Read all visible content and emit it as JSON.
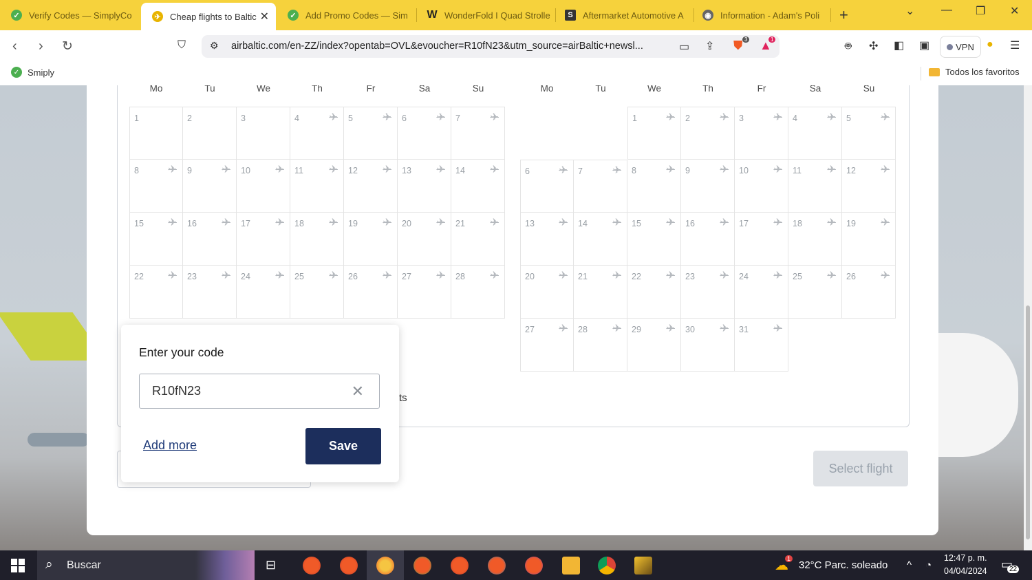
{
  "tabs": [
    {
      "label": "Verify Codes — SimplyCo",
      "color": "#4caf50",
      "glyph": "✓"
    },
    {
      "label": "Cheap flights to Baltic",
      "color": "#e8b400",
      "glyph": "✈",
      "active": true
    },
    {
      "label": "Add Promo Codes — Sim",
      "color": "#4caf50",
      "glyph": "✓"
    },
    {
      "label": "WonderFold I Quad Strolle",
      "color": "#222",
      "glyph": "W"
    },
    {
      "label": "Aftermarket Automotive A",
      "color": "#333",
      "glyph": "S"
    },
    {
      "label": "Information - Adam's Poli",
      "color": "#666",
      "glyph": "◉"
    }
  ],
  "url": "airbaltic.com/en-ZZ/index?opentab=OVL&evoucher=R10fN23&utm_source=airBaltic+newsl...",
  "bookmarks": {
    "left": "Smiply",
    "right": "Todos los favoritos"
  },
  "vpn_label": "VPN",
  "brave_badge": "3",
  "rewards_badge": "1",
  "calendar": {
    "weekdays": [
      "Mo",
      "Tu",
      "We",
      "Th",
      "Fr",
      "Sa",
      "Su"
    ],
    "month1_days": [
      "1",
      "2",
      "3",
      "4",
      "5",
      "6",
      "7",
      "8",
      "9",
      "10",
      "11",
      "12",
      "13",
      "14",
      "15",
      "16",
      "17",
      "18",
      "19",
      "20",
      "21",
      "22",
      "23",
      "24",
      "25",
      "26",
      "27",
      "28"
    ],
    "month2_days": [
      "1",
      "2",
      "3",
      "4",
      "5",
      "6",
      "7",
      "8",
      "9",
      "10",
      "11",
      "12",
      "13",
      "14",
      "15",
      "16",
      "17",
      "18",
      "19",
      "20",
      "21",
      "22",
      "23",
      "24",
      "25",
      "26",
      "27",
      "28",
      "29",
      "30",
      "31"
    ]
  },
  "behind_text": "ts",
  "select_flight": "Select flight",
  "popup": {
    "title": "Enter your code",
    "code_value": "R10fN23",
    "add_more": "Add more",
    "save": "Save"
  },
  "taskbar": {
    "search": "Buscar",
    "weather": "32°C  Parc. soleado",
    "time": "12:47 p. m.",
    "date": "04/04/2024",
    "notif": "22",
    "weather_badge": "1"
  }
}
